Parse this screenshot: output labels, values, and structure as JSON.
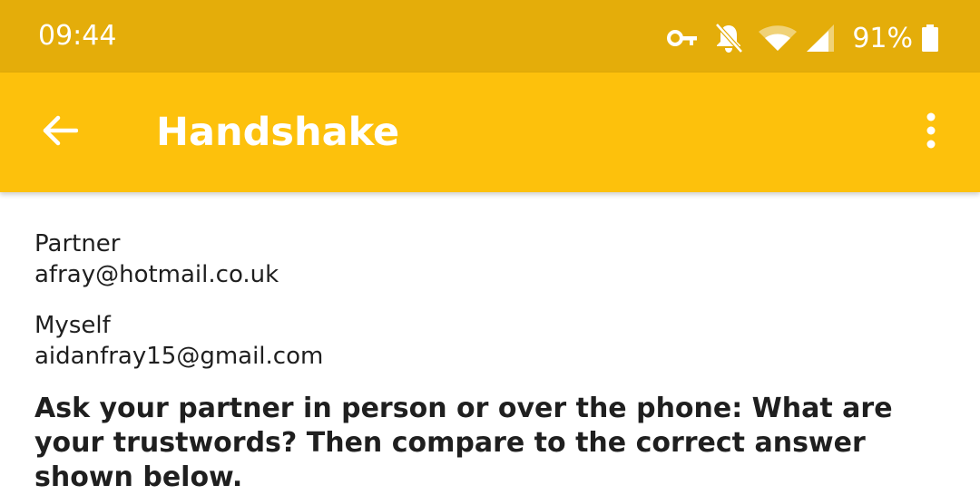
{
  "status_bar": {
    "time": "09:44",
    "battery_percent": "91%",
    "icons": [
      "vpn-key-icon",
      "notifications-off-icon",
      "wifi-icon",
      "cell-signal-icon",
      "battery-icon"
    ]
  },
  "app_bar": {
    "title": "Handshake",
    "back_icon": "arrow-back-icon",
    "menu_icon": "more-vert-icon"
  },
  "partner": {
    "label": "Partner",
    "email": "afray@hotmail.co.uk"
  },
  "myself": {
    "label": "Myself",
    "email": "aidanfray15@gmail.com"
  },
  "instructions": "Ask your partner in person or over the phone: What are your trustwords? Then compare to the correct answer shown below.",
  "colors": {
    "status_bar": "#e4ad0a",
    "app_bar": "#fdc10c",
    "text": "#1f1f1f"
  }
}
